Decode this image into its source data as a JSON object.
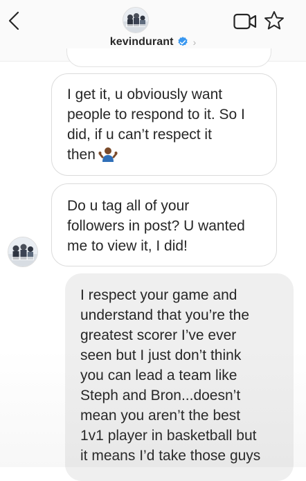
{
  "header": {
    "username": "kevindurant",
    "verified": true,
    "icons": {
      "back": "chevron-left-icon",
      "video": "video-camera-icon",
      "star": "star-icon",
      "verified": "verified-badge-icon",
      "profile_chevron": "chevron-right-icon"
    }
  },
  "colors": {
    "verified_blue": "#3897f0",
    "incoming_bubble": "#efefef",
    "outgoing_border": "#dbdbdb",
    "text": "#262626"
  },
  "messages": [
    {
      "direction": "outgoing",
      "lines": [
        "I get it, u obviously want",
        "people to respond to it. So I",
        "did, if u can’t respect it",
        "then"
      ],
      "emoji": "person-shrugging-icon"
    },
    {
      "direction": "outgoing",
      "lines": [
        "Do u tag all of your",
        "followers in post? U wanted",
        "me to view it, I did!"
      ]
    },
    {
      "direction": "incoming",
      "lines": [
        "I respect your game and",
        "understand that you’re the",
        "greatest scorer I’ve ever",
        "seen but I just don’t think",
        "you can lead a team like",
        "Steph and Bron...doesn’t",
        "mean you aren’t the best",
        "1v1 player in basketball but",
        "it means I’d take those guys"
      ]
    }
  ]
}
